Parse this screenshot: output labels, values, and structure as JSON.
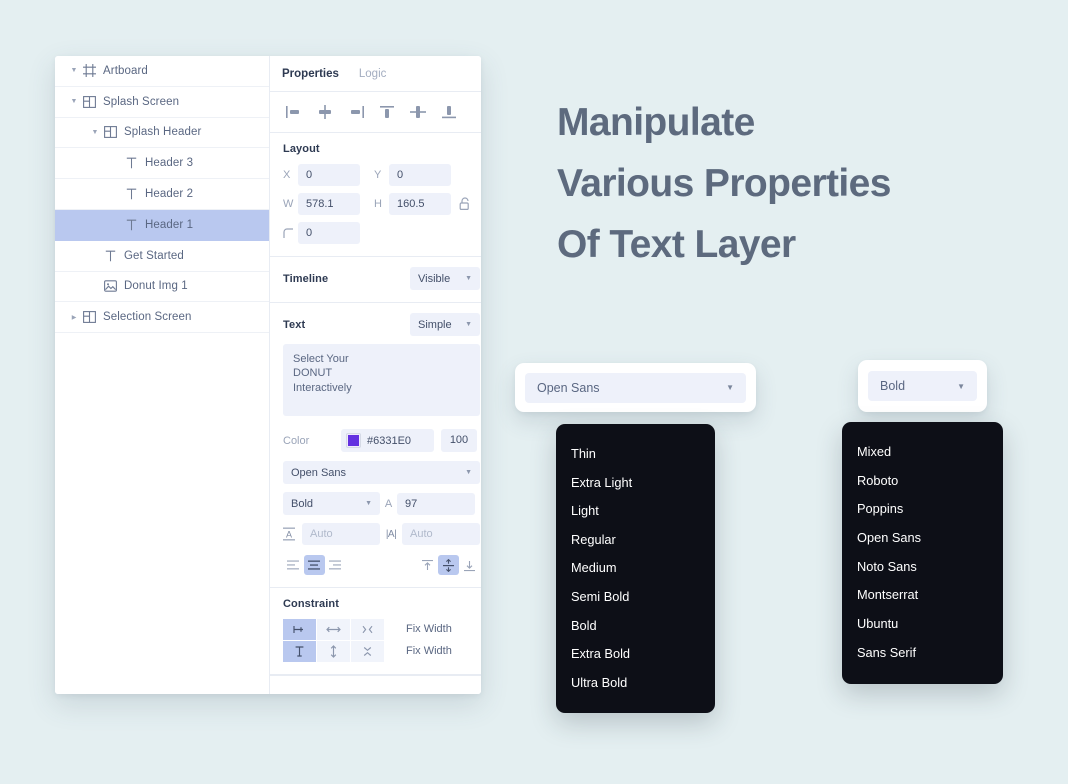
{
  "headline": {
    "line1": "Manipulate",
    "line2": "Various Properties",
    "line3": "Of Text Layer",
    "color": "#5d6a7e"
  },
  "layer_tree": {
    "items": [
      {
        "label": "Artboard",
        "icon": "artboard-icon",
        "twisty": "down",
        "indent": 0,
        "selected": false
      },
      {
        "label": "Splash Screen",
        "icon": "frame-icon",
        "twisty": "down",
        "indent": 0,
        "selected": false
      },
      {
        "label": "Splash Header",
        "icon": "frame-icon",
        "twisty": "down",
        "indent": 1,
        "selected": false
      },
      {
        "label": "Header 3",
        "icon": "text-icon",
        "twisty": "none",
        "indent": 2,
        "selected": false
      },
      {
        "label": "Header 2",
        "icon": "text-icon",
        "twisty": "none",
        "indent": 2,
        "selected": false
      },
      {
        "label": "Header 1",
        "icon": "text-icon",
        "twisty": "none",
        "indent": 2,
        "selected": true
      },
      {
        "label": "Get Started",
        "icon": "text-icon",
        "twisty": "none",
        "indent": 1,
        "selected": false
      },
      {
        "label": "Donut Img 1",
        "icon": "image-icon",
        "twisty": "none",
        "indent": 1,
        "selected": false
      },
      {
        "label": "Selection Screen",
        "icon": "frame-icon",
        "twisty": "right",
        "indent": 0,
        "selected": false
      }
    ],
    "selection_color": "#b9c8ef"
  },
  "properties_panel": {
    "tabs": {
      "active": "Properties",
      "inactive": "Logic"
    },
    "align_icons": [
      "align-left-icon",
      "align-horizontal-center-icon",
      "align-right-icon",
      "align-top-icon",
      "align-vertical-center-icon",
      "align-bottom-icon"
    ],
    "layout": {
      "title": "Layout",
      "x_label": "X",
      "x_value": "0",
      "y_label": "Y",
      "y_value": "0",
      "w_label": "W",
      "w_value": "578.1",
      "h_label": "H",
      "h_value": "160.5",
      "radius_label": "corner-radius-icon",
      "radius_value": "0",
      "lock_icon": "unlocked-icon"
    },
    "timeline": {
      "title": "Timeline",
      "value": "Visible"
    },
    "text": {
      "title": "Text",
      "mode": "Simple",
      "content": "Select Your\nDONUT\nInteractively",
      "color_label": "Color",
      "color_hex": "#6331E0",
      "color_swatch": "#6331E0",
      "opacity": "100",
      "font_family": "Open Sans",
      "font_weight": "Bold",
      "size_label": "A",
      "size_value": "97",
      "line_height_icon": "line-height-icon",
      "line_height_value": "Auto",
      "letter_spacing_icon": "letter-spacing-icon",
      "letter_spacing_value": "Auto",
      "h_align": {
        "options": [
          "align-text-left-icon",
          "align-text-center-icon",
          "align-text-right-icon"
        ],
        "active_index": 1
      },
      "v_align": {
        "options": [
          "align-text-top-icon",
          "align-text-middle-icon",
          "align-text-bottom-icon"
        ],
        "active_index": 1
      }
    },
    "constraint": {
      "title": "Constraint",
      "cells": [
        {
          "icon": "pin-left-icon",
          "on": true
        },
        {
          "icon": "resize-h-icon",
          "on": false
        },
        {
          "icon": "pin-right-icon",
          "on": false
        },
        {
          "icon": "pin-top-icon",
          "on": true
        },
        {
          "icon": "resize-v-icon",
          "on": false
        },
        {
          "icon": "pin-bottom-icon",
          "on": false
        }
      ],
      "label_row1": "Fix Width",
      "label_row2": "Fix Width"
    }
  },
  "font_picker": {
    "selected": "Open Sans",
    "caret_icon": "chevron-down-icon",
    "menu_items": [
      "Thin",
      "Extra Light",
      "Light",
      "Regular",
      "Medium",
      "Semi Bold",
      "Bold",
      "Extra Bold",
      "Ultra Bold"
    ]
  },
  "weight_picker": {
    "selected": "Bold",
    "caret_icon": "chevron-down-icon",
    "menu_items": [
      "Mixed",
      "Roboto",
      "Poppins",
      "Open Sans",
      "Noto Sans",
      "Montserrat",
      "Ubuntu",
      "Sans Serif"
    ]
  },
  "theme": {
    "background": "#e4eff1",
    "menu_background": "#0d0f17",
    "field_background": "#eef1fa",
    "accent": "#b9c8ef"
  }
}
